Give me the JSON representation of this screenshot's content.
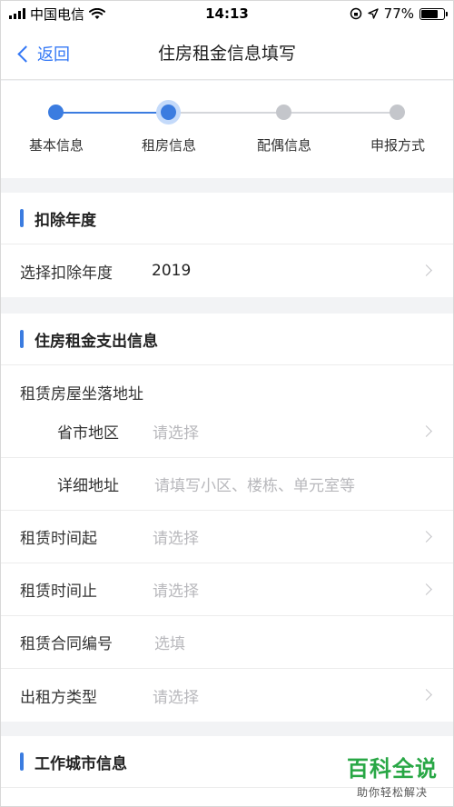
{
  "status_bar": {
    "carrier": "中国电信",
    "time": "14:13",
    "battery": "77%",
    "battery_level": 0.77
  },
  "nav": {
    "back_label": "返回",
    "title": "住房租金信息填写"
  },
  "steps": [
    {
      "label": "基本信息",
      "state": "done"
    },
    {
      "label": "租房信息",
      "state": "active"
    },
    {
      "label": "配偶信息",
      "state": "pending"
    },
    {
      "label": "申报方式",
      "state": "pending"
    }
  ],
  "sections": {
    "deduction_year": {
      "title": "扣除年度",
      "row": {
        "label": "选择扣除年度",
        "value": "2019"
      }
    },
    "rent_expense": {
      "title": "住房租金支出信息",
      "address_group_label": "租赁房屋坐落地址",
      "province": {
        "label": "省市地区",
        "placeholder": "请选择"
      },
      "detail": {
        "label": "详细地址",
        "placeholder": "请填写小区、楼栋、单元室等"
      },
      "start": {
        "label": "租赁时间起",
        "placeholder": "请选择"
      },
      "end": {
        "label": "租赁时间止",
        "placeholder": "请选择"
      },
      "contract": {
        "label": "租赁合同编号",
        "placeholder": "选填"
      },
      "lessor_type": {
        "label": "出租方类型",
        "placeholder": "请选择"
      }
    },
    "work_city": {
      "title": "工作城市信息"
    }
  },
  "watermark": {
    "title": "百科全说",
    "subtitle": "助你轻松解决"
  },
  "colors": {
    "accent": "#3b7ce0",
    "link": "#3478f6",
    "pending": "#c4c6cb",
    "watermark": "#28a745"
  }
}
